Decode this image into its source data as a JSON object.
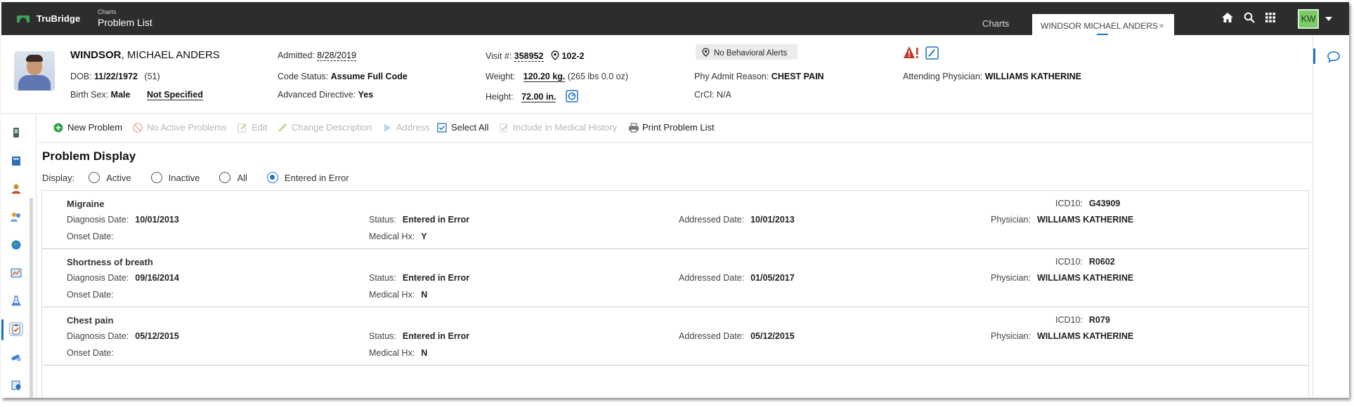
{
  "topbar": {
    "logo": "TruBridge",
    "breadcrumb_small": "Charts",
    "breadcrumb_big": "Problem List",
    "tabs": [
      {
        "label": "Charts"
      },
      {
        "label": "WINDSOR MICHAEL ANDERS"
      }
    ],
    "close_glyph": "×",
    "user_initials": "KW",
    "icons": [
      "home-icon",
      "search-icon",
      "apps-grid-icon"
    ]
  },
  "patient": {
    "last_name": "WINDSOR",
    "first_names": ", MICHAEL ANDERS",
    "dob_label": "DOB:",
    "dob": "11/22/1972",
    "age": "(51)",
    "birth_sex_label": "Birth Sex:",
    "birth_sex": "Male",
    "not_specified": "Not Specified",
    "admitted_label": "Admitted:",
    "admitted": "8/28/2019",
    "code_status_label": "Code Status:",
    "code_status": "Assume Full Code",
    "advanced_directive_label": "Advanced Directive:",
    "advanced_directive": "Yes",
    "visit_label": "Visit #:",
    "visit": "358952",
    "room": "102-2",
    "weight_label": "Weight:",
    "weight": "120.20 kg.",
    "weight_lbs": "(265 lbs 0.0 oz)",
    "height_label": "Height:",
    "height": "72.00 in.",
    "behavioral_alert": "No Behavioral Alerts",
    "admit_reason_label": "Phy Admit Reason:",
    "admit_reason": "CHEST PAIN",
    "crcl_label": "CrCl:",
    "crcl": "N/A",
    "attending_label": "Attending Physician:",
    "attending": "WILLIAMS KATHERINE"
  },
  "toolbar": {
    "items": [
      {
        "label": "New Problem",
        "enabled": true
      },
      {
        "label": "No Active Problems",
        "enabled": false
      },
      {
        "label": "Edit",
        "enabled": false
      },
      {
        "label": "Change Description",
        "enabled": false
      },
      {
        "label": "Address",
        "enabled": false
      },
      {
        "label": "Select All",
        "enabled": true
      },
      {
        "label": "Include in Medical History",
        "enabled": false
      },
      {
        "label": "Print Problem List",
        "enabled": true
      }
    ]
  },
  "problem_display": {
    "title": "Problem Display",
    "display_label": "Display:",
    "options": [
      "Active",
      "Inactive",
      "All",
      "Entered in Error"
    ],
    "selected": "Entered in Error"
  },
  "labels": {
    "diagnosis_date": "Diagnosis Date:",
    "onset_date": "Onset Date:",
    "status": "Status:",
    "medical_hx": "Medical Hx:",
    "addressed_date": "Addressed Date:",
    "icd10": "ICD10:",
    "physician": "Physician:"
  },
  "problems": [
    {
      "name": "Migraine",
      "diagnosis_date": "10/01/2013",
      "onset_date": "",
      "status": "Entered in Error",
      "medical_hx": "Y",
      "addressed_date": "10/01/2013",
      "icd10": "G43909",
      "physician": "WILLIAMS KATHERINE"
    },
    {
      "name": "Shortness of breath",
      "diagnosis_date": "09/16/2014",
      "onset_date": "",
      "status": "Entered in Error",
      "medical_hx": "N",
      "addressed_date": "01/05/2017",
      "icd10": "R0602",
      "physician": "WILLIAMS KATHERINE"
    },
    {
      "name": "Chest pain",
      "diagnosis_date": "05/12/2015",
      "onset_date": "",
      "status": "Entered in Error",
      "medical_hx": "N",
      "addressed_date": "05/12/2015",
      "icd10": "R079",
      "physician": "WILLIAMS KATHERINE"
    }
  ],
  "left_rail_icons": [
    "device-icon",
    "book-icon",
    "person-icon",
    "people-icon",
    "globe-icon",
    "chart-icon",
    "flask-icon",
    "clipboard-icon",
    "pills-icon",
    "records-icon"
  ],
  "colors": {
    "accent": "#1a73c9",
    "topbar": "#2d2d2d",
    "avatar": "#7cc96a",
    "alert": "#c0392b"
  }
}
